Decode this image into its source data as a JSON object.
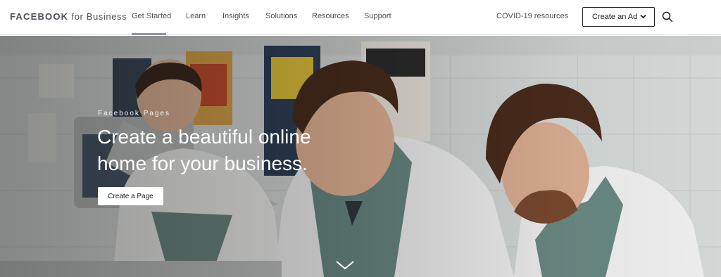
{
  "nav": {
    "brand_bold": "FACEBOOK",
    "brand_rest": " for Business",
    "links": [
      "Get Started",
      "Learn",
      "Insights",
      "Solutions",
      "Resources",
      "Support"
    ],
    "covid": "COVID-19 resources",
    "create_ad": "Create an Ad",
    "active_index": 0
  },
  "hero": {
    "eyebrow": "Facebook Pages",
    "headline": "Create a beautiful online home for your business.",
    "cta": "Create a Page"
  },
  "icons": {
    "search": "search-icon",
    "dropdown": "chevron-down-icon",
    "scroll": "chevron-down-icon"
  }
}
